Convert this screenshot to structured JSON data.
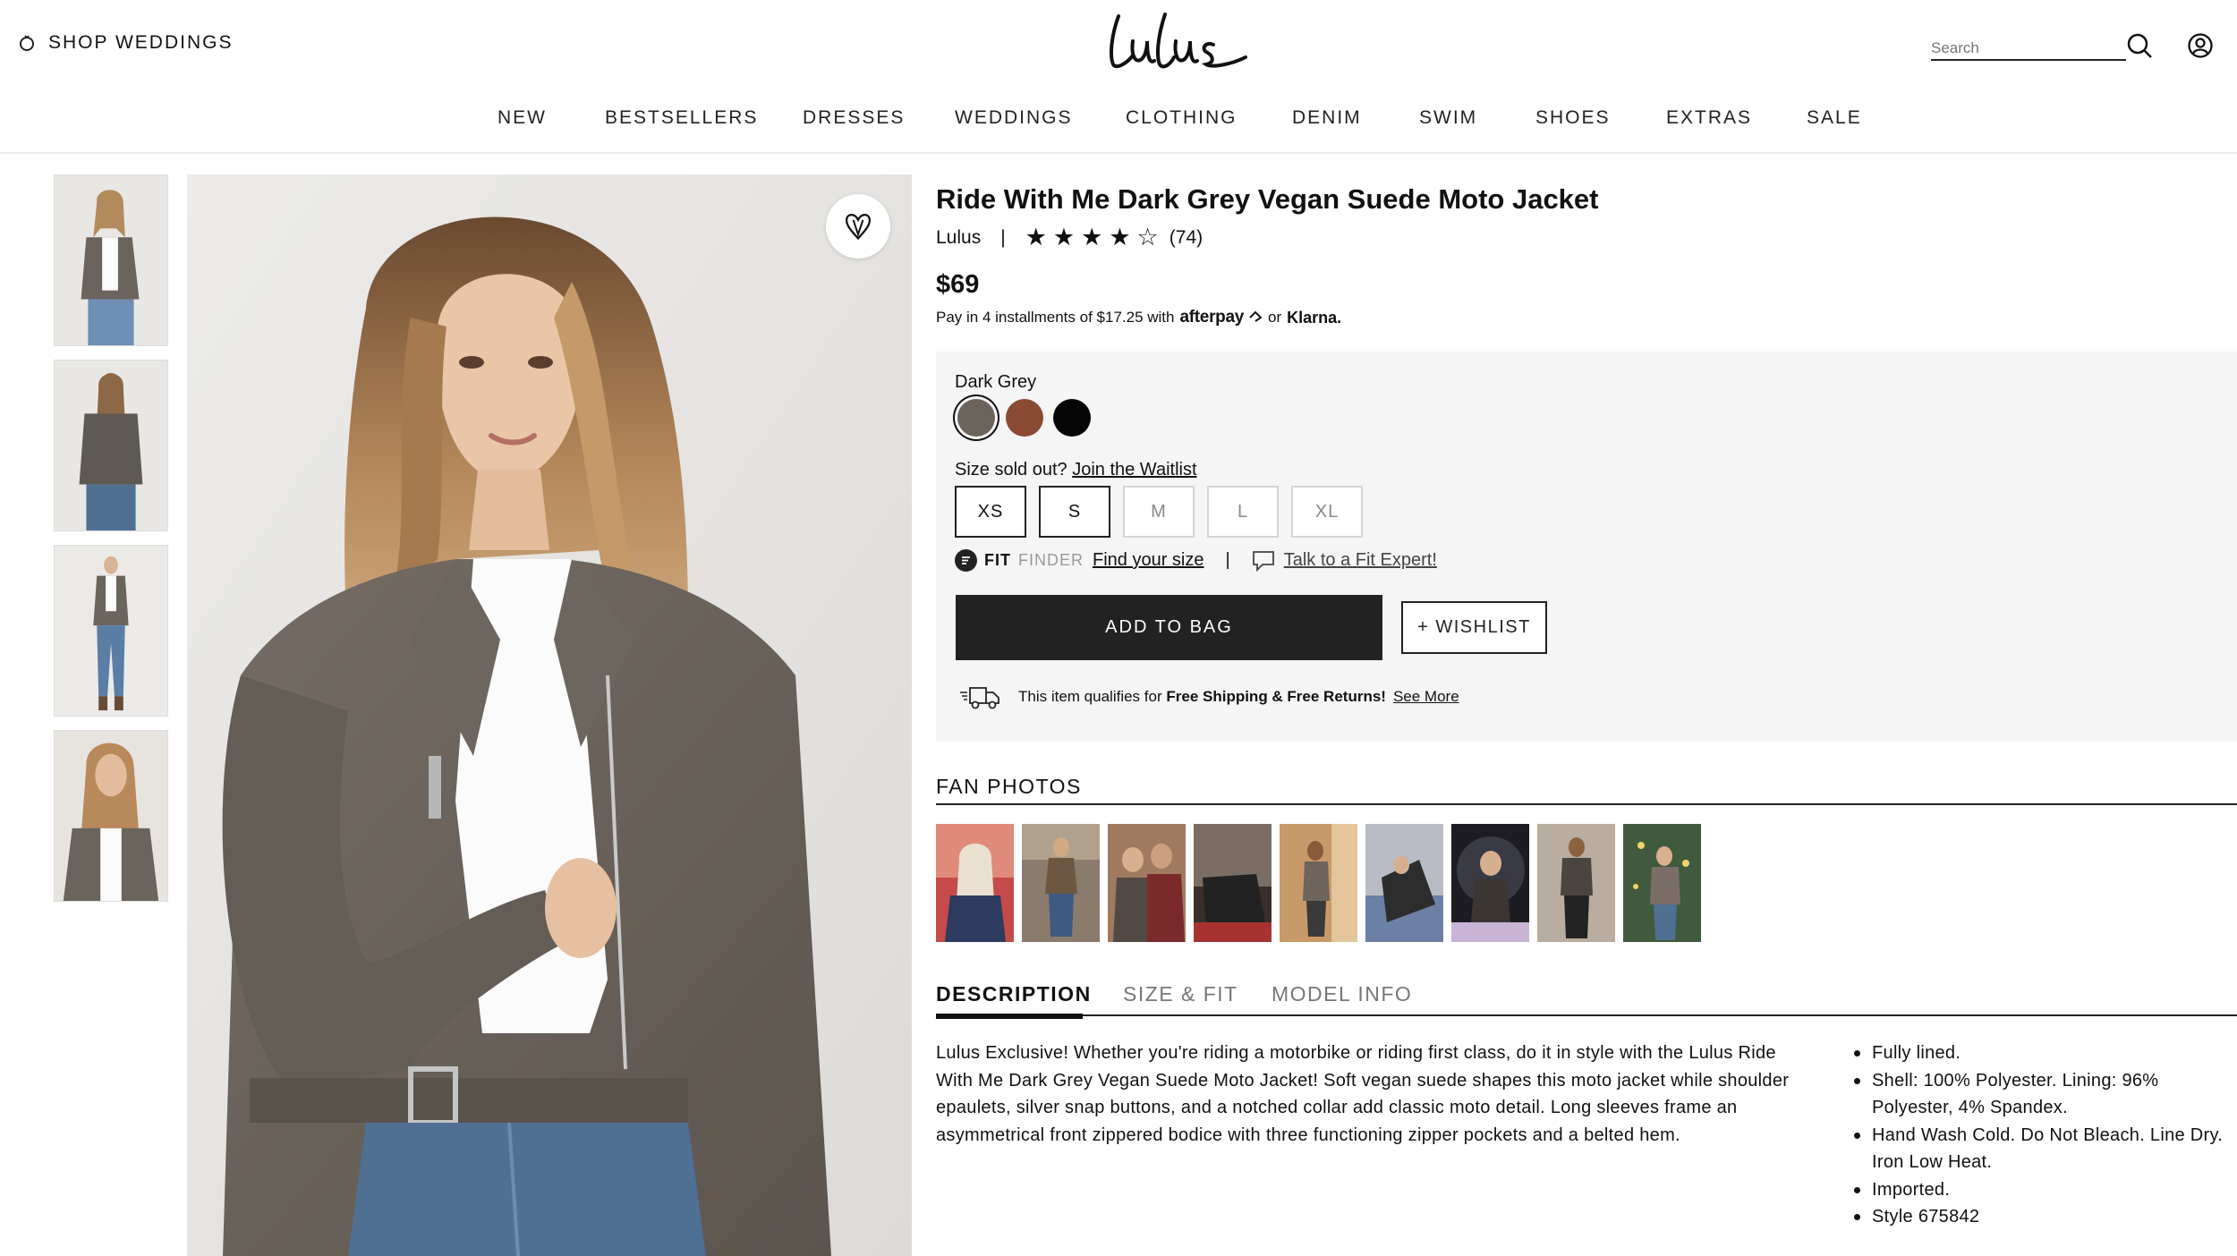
{
  "header": {
    "shop_weddings": "SHOP WEDDINGS",
    "logo_text": "Lulus",
    "search_placeholder": "Search",
    "nav": [
      "NEW",
      "BESTSELLERS",
      "DRESSES",
      "WEDDINGS",
      "CLOTHING",
      "DENIM",
      "SWIM",
      "SHOES",
      "EXTRAS",
      "SALE"
    ]
  },
  "product": {
    "title": "Ride With Me Dark Grey Vegan Suede Moto Jacket",
    "brand": "Lulus",
    "rating": 4,
    "rating_max": 5,
    "review_count": "(74)",
    "price": "$69",
    "installments_text": "Pay in 4 installments of $17.25 with",
    "afterpay": "afterpay",
    "or": "or",
    "klarna": "Klarna."
  },
  "options": {
    "selected_color": "Dark Grey",
    "colors": [
      {
        "name": "Dark Grey",
        "hex": "#6b645d",
        "selected": true
      },
      {
        "name": "Brown",
        "hex": "#8b4a33",
        "selected": false
      },
      {
        "name": "Black",
        "hex": "#050505",
        "selected": false
      }
    ],
    "size_prompt": "Size sold out?",
    "waitlist": "Join the Waitlist",
    "sizes": [
      {
        "label": "XS",
        "available": true
      },
      {
        "label": "S",
        "available": true
      },
      {
        "label": "M",
        "available": false
      },
      {
        "label": "L",
        "available": false
      },
      {
        "label": "XL",
        "available": false
      }
    ],
    "fit_logo_fit": "FIT",
    "fit_logo_finder": "FINDER",
    "find_size": "Find your size",
    "pipe": "|",
    "fit_expert": "Talk to a Fit Expert!",
    "add_to_bag": "ADD TO BAG",
    "wishlist": "+ WISHLIST",
    "shipping_prefix": "This item qualifies for",
    "shipping_bold": "Free Shipping & Free Returns!",
    "see_more": "See More"
  },
  "fan_photos": {
    "title": "FAN PHOTOS",
    "count": 9
  },
  "tabs": {
    "items": [
      "DESCRIPTION",
      "SIZE & FIT",
      "MODEL INFO"
    ],
    "active": "DESCRIPTION"
  },
  "description": "Lulus Exclusive! Whether you're riding a motorbike or riding first class, do it in style with the Lulus Ride With Me Dark Grey Vegan Suede Moto Jacket! Soft vegan suede shapes this moto jacket while shoulder epaulets, silver snap buttons, and a notched collar add classic moto detail. Long sleeves frame an asymmetrical front zippered bodice with three functioning zipper pockets and a belted hem.",
  "details": [
    "Fully lined.",
    "Shell: 100% Polyester. Lining: 96% Polyester, 4% Spandex.",
    "Hand Wash Cold. Do Not Bleach. Line Dry. Iron Low Heat.",
    "Imported.",
    "Style 675842"
  ],
  "colors": {
    "text": "#111111",
    "panel_bg": "#f5f5f5",
    "button_dark": "#222222",
    "jacket": "#6b645d",
    "denim": "#4f6f93"
  }
}
